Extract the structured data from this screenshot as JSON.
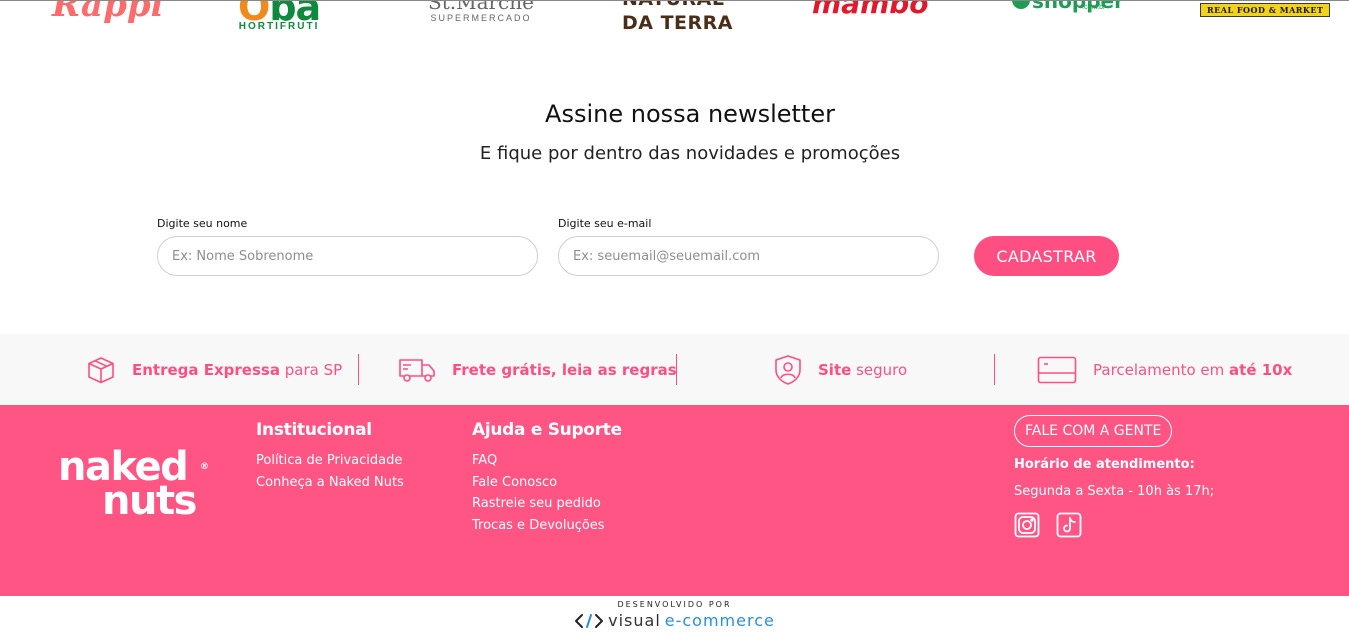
{
  "partner_logos": {
    "rappi": "Rappi",
    "oba_big_o": "O",
    "oba_big_rest": "ba",
    "oba_small": "HORTIFRUTI",
    "super_big": "St.Marche",
    "super_small": "SUPERMERCADO",
    "natural_line1": "NATURAL",
    "natural_line2": "DA TERRA",
    "mambo": "mambo",
    "shopper": "shopper",
    "shopper_sub": ".com.br",
    "realfood": "REAL FOOD & MARKET"
  },
  "newsletter": {
    "title": "Assine nossa newsletter",
    "subtitle": "E fique por dentro das novidades e promoções",
    "name_label": "Digite seu nome",
    "name_placeholder": "Ex: Nome Sobrenome",
    "name_value": "",
    "email_label": "Digite seu e-mail",
    "email_placeholder": "Ex: seuemail@seuemail.com",
    "email_value": "",
    "submit_label": "CADASTRAR"
  },
  "features": [
    {
      "strong": "Entrega Expressa",
      "light": " para SP",
      "icon": "box-icon"
    },
    {
      "strong": "Frete grátis, leia as regras",
      "light": "",
      "icon": "truck-icon"
    },
    {
      "strong": "Site",
      "light": " seguro",
      "icon": "shield-user-icon"
    },
    {
      "light_first": "Parcelamento em ",
      "strong": "até 10x",
      "icon": "credit-card-icon"
    }
  ],
  "footer": {
    "brand_line1": "naked",
    "brand_line2": "nuts",
    "brand_reg": "®",
    "institucional": {
      "title": "Institucional",
      "links": [
        "Política de Privacidade",
        "Conheça a Naked Nuts"
      ]
    },
    "ajuda": {
      "title": "Ajuda e Suporte",
      "links": [
        "FAQ",
        "Fale Conosco",
        "Rastreie seu pedido",
        "Trocas e Devoluções"
      ]
    },
    "contact_button": "FALE COM A GENTE",
    "hours_title": "Horário de atendimento:",
    "hours_text": "Segunda a Sexta - 10h às 17h;",
    "social": [
      "instagram-icon",
      "tiktok-icon"
    ]
  },
  "credit": {
    "developed_by": "DESENVOLVIDO POR",
    "brand_visual": "visual",
    "brand_ecommerce": "e-commerce"
  },
  "colors": {
    "accent": "#ff4f82",
    "footer_bg": "#ff5584",
    "features_bg": "#f8f8f8"
  }
}
